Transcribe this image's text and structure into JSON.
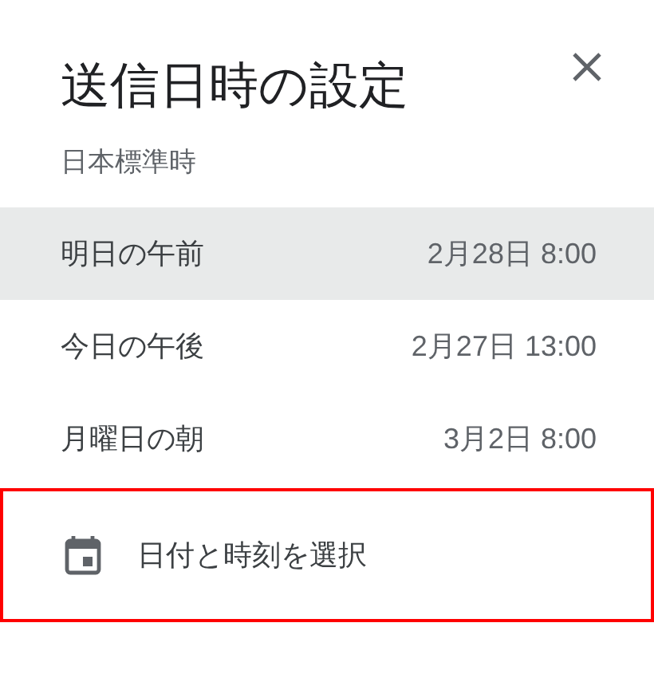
{
  "dialog": {
    "title": "送信日時の設定",
    "subtitle": "日本標準時"
  },
  "options": [
    {
      "label": "明日の午前",
      "time": "2月28日 8:00",
      "selected": true
    },
    {
      "label": "今日の午後",
      "time": "2月27日 13:00",
      "selected": false
    },
    {
      "label": "月曜日の朝",
      "time": "3月2日 8:00",
      "selected": false
    }
  ],
  "custom": {
    "label": "日付と時刻を選択",
    "highlighted": true
  }
}
